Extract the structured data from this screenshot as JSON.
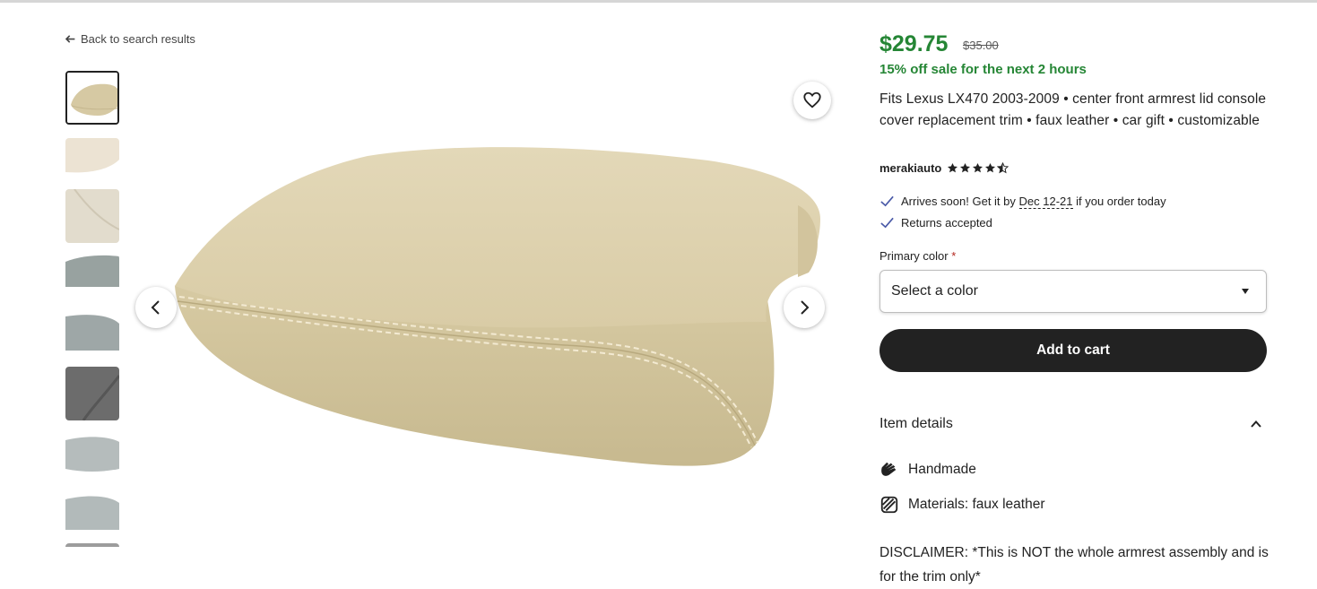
{
  "nav": {
    "back_label": "Back to search results"
  },
  "listing": {
    "price": "$29.75",
    "original_price": "$35.00",
    "sale_text": "15% off sale for the next 2 hours",
    "title": "Fits Lexus LX470 2003-2009 • center front armrest lid console cover replacement trim • faux leather • car gift • customizable",
    "shop_name": "merakiauto",
    "rating": 4.5,
    "rating_max": 5
  },
  "shipping": {
    "arrival_prefix": "Arrives soon! Get it by",
    "arrival_dates": "Dec 12-21",
    "arrival_suffix": "if you order today",
    "returns": "Returns accepted"
  },
  "variation": {
    "label": "Primary color",
    "required_mark": "*",
    "placeholder": "Select a color"
  },
  "actions": {
    "add_to_cart": "Add to cart"
  },
  "details": {
    "heading": "Item details",
    "handmade": "Handmade",
    "materials": "Materials: faux leather",
    "disclaimer": "DISCLAIMER: *This is NOT the whole armrest assembly and is for the trim only*"
  },
  "colors": {
    "sale_green": "#258635",
    "button_dark": "#222222",
    "check_blue": "#4a5aa8",
    "product_beige": "#dfd2ae"
  },
  "icons": [
    "arrow-left-icon",
    "heart-icon",
    "chevron-left-icon",
    "chevron-right-icon",
    "star-icon",
    "checkmark-icon",
    "chevron-down-icon",
    "chevron-up-icon",
    "hand-icon",
    "materials-icon"
  ]
}
